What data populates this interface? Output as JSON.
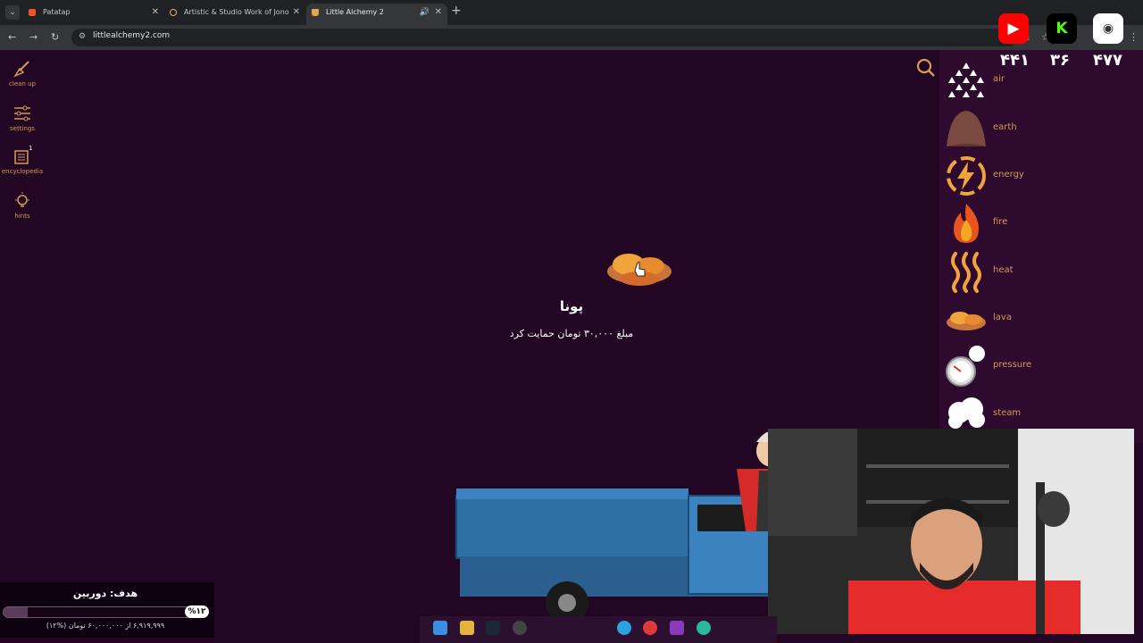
{
  "browser": {
    "tabs": [
      {
        "title": "Patatap",
        "active": false
      },
      {
        "title": "Artistic & Studio Work of Jono",
        "active": false
      },
      {
        "title": "Little Alchemy 2",
        "active": true
      }
    ],
    "url": "littlealchemy2.com"
  },
  "sidebar": {
    "tools": [
      {
        "label": "clean up",
        "icon": "broom-icon"
      },
      {
        "label": "settings",
        "icon": "sliders-icon"
      },
      {
        "label": "encyclopedia",
        "icon": "book-icon",
        "badge": "1"
      },
      {
        "label": "hints",
        "icon": "lightbulb-icon"
      }
    ]
  },
  "counters": [
    "۴۴۱",
    "۳۶",
    "۴۷۷"
  ],
  "elements": [
    {
      "label": "air",
      "icon": "air-icon"
    },
    {
      "label": "earth",
      "icon": "earth-icon"
    },
    {
      "label": "energy",
      "icon": "energy-icon"
    },
    {
      "label": "fire",
      "icon": "fire-icon"
    },
    {
      "label": "heat",
      "icon": "heat-icon"
    },
    {
      "label": "lava",
      "icon": "lava-icon"
    },
    {
      "label": "pressure",
      "icon": "pressure-icon"
    },
    {
      "label": "steam",
      "icon": "steam-icon"
    }
  ],
  "donation_alert": {
    "name": "پونا",
    "message": "مبلغ ۳۰,۰۰۰ تومان حمایت کرد"
  },
  "goal": {
    "title": "هدف: دوربین",
    "percent_label": "%۱۲",
    "progress": 0.12,
    "amount": "۶,۹۱۹,۹۹۹ از ۶۰,۰۰۰,۰۰۰ تومان (%۱۲)"
  },
  "social": [
    {
      "name": "youtube-icon",
      "color": "#ff0000"
    },
    {
      "name": "kick-icon",
      "color": "#53fc18"
    },
    {
      "name": "eye-icon",
      "color": "#ffffff"
    }
  ],
  "colors": {
    "background": "#230624",
    "panel": "#2d0a2e",
    "accent": "#d39b55"
  }
}
